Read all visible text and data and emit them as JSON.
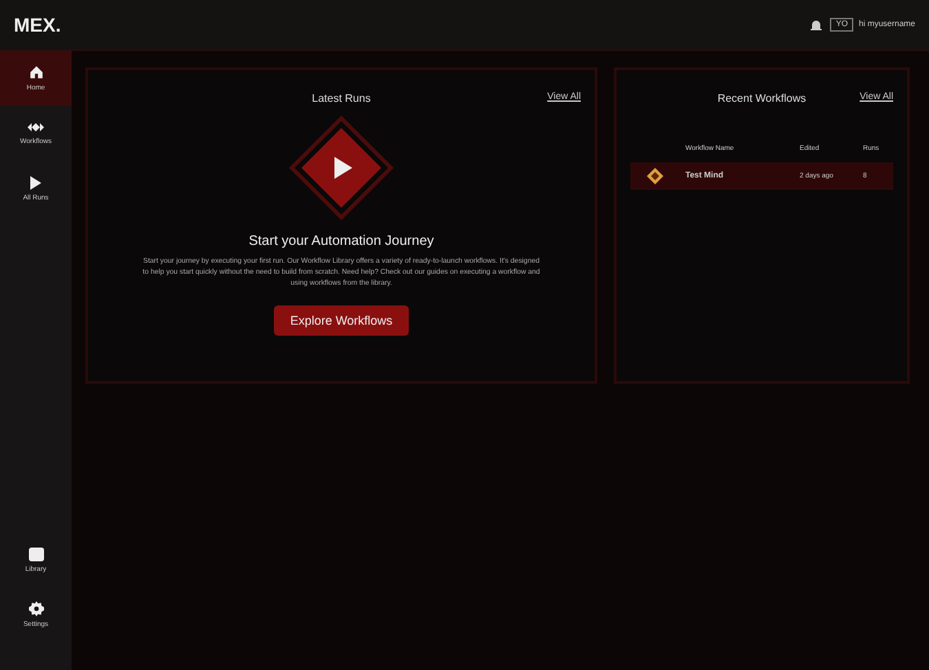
{
  "header": {
    "logo": "MEX.",
    "avatar": "YO",
    "user": "hi myusername"
  },
  "sidebar": {
    "top": [
      {
        "label": "Home",
        "selected": true
      },
      {
        "label": "Workflows",
        "selected": false
      },
      {
        "label": "All Runs",
        "selected": false
      }
    ],
    "bottom": [
      {
        "label": "Library",
        "selected": false
      },
      {
        "label": "Settings",
        "selected": false
      }
    ]
  },
  "latest_runs": {
    "title": "Latest Runs",
    "view_all": "View All",
    "heading": "Start your Automation Journey",
    "body": "Start your journey by executing your first run. Our Workflow Library offers a variety of ready-to-launch workflows. It's designed to help you start quickly without the need to build from scratch. Need help? Check out our guides on executing a workflow and using workflows from the library.",
    "button": "Explore Workflows"
  },
  "recent_workflows": {
    "title": "Recent Workflows",
    "view_all": "View All",
    "columns": [
      "Workflow Name",
      "Edited",
      "Runs"
    ],
    "rows": [
      {
        "name": "Test Mind",
        "edited": "2 days ago",
        "runs": "8"
      }
    ]
  }
}
